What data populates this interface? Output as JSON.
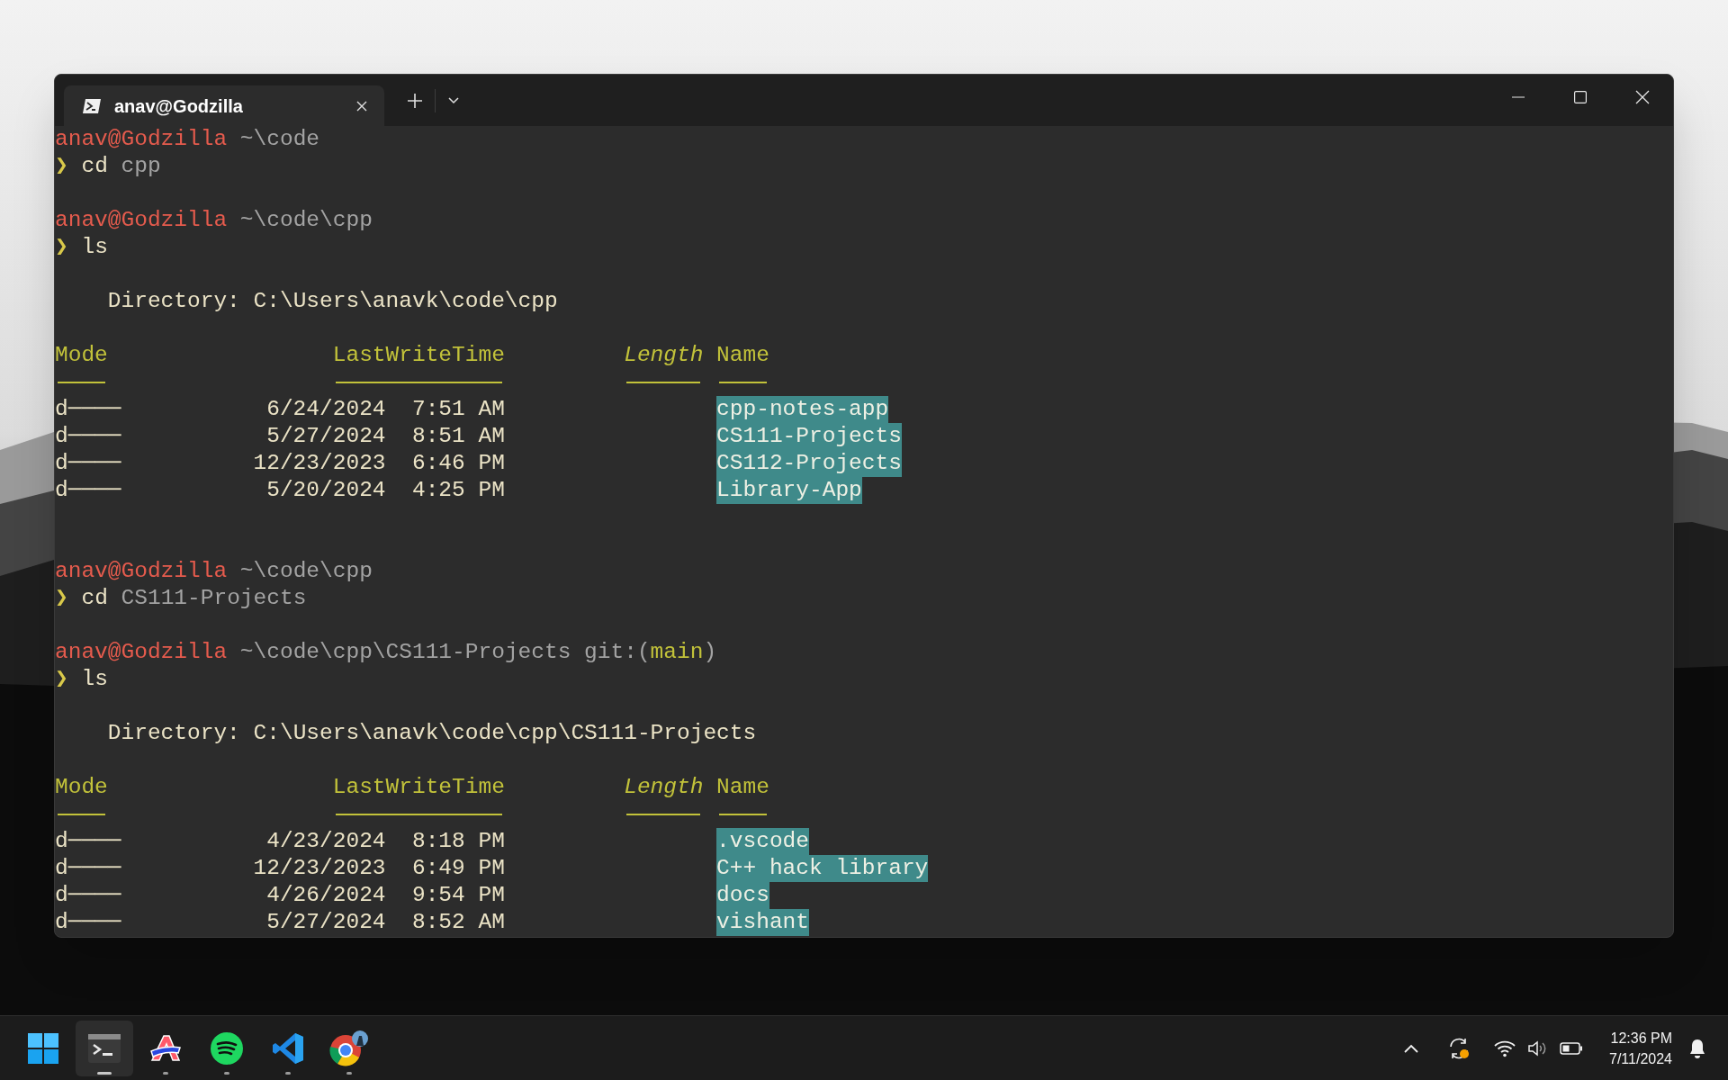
{
  "window": {
    "tabs": [
      {
        "title": "anav@Godzilla",
        "selected": true
      }
    ]
  },
  "terminal": {
    "lines": [
      {
        "kind": "text",
        "segments": [
          {
            "text": "anav@Godzilla",
            "kind": "user"
          },
          {
            "text": "~\\code",
            "kind": "path"
          }
        ]
      },
      {
        "kind": "text",
        "segments": [
          {
            "text": "❯",
            "kind": "prompt"
          },
          {
            "text": "cd",
            "kind": "command"
          },
          {
            "text": "cpp",
            "kind": "arg"
          }
        ]
      },
      {
        "kind": "blank"
      },
      {
        "kind": "text",
        "segments": [
          {
            "text": "anav@Godzilla",
            "kind": "user"
          },
          {
            "text": "~\\code\\cpp",
            "kind": "path"
          }
        ]
      },
      {
        "kind": "text",
        "segments": [
          {
            "text": "❯",
            "kind": "prompt"
          },
          {
            "text": "ls",
            "kind": "command"
          }
        ]
      },
      {
        "kind": "blank"
      },
      {
        "kind": "directory",
        "text": "Directory: C:\\Users\\anavk\\code\\cpp"
      },
      {
        "kind": "blank"
      },
      {
        "kind": "table_head",
        "mode": "Mode",
        "time": "LastWriteTime",
        "length": "Length",
        "name": "Name"
      },
      {
        "kind": "table_rule"
      },
      {
        "kind": "table_row",
        "mode": "d────",
        "date": "6/24/2024",
        "time": "7:51 AM",
        "name": "cpp-notes-app"
      },
      {
        "kind": "table_row",
        "mode": "d────",
        "date": "5/27/2024",
        "time": "8:51 AM",
        "name": "CS111-Projects"
      },
      {
        "kind": "table_row",
        "mode": "d────",
        "date": "12/23/2023",
        "time": "6:46 PM",
        "name": "CS112-Projects"
      },
      {
        "kind": "table_row",
        "mode": "d────",
        "date": "5/20/2024",
        "time": "4:25 PM",
        "name": "Library-App"
      },
      {
        "kind": "blank"
      },
      {
        "kind": "blank"
      },
      {
        "kind": "text",
        "segments": [
          {
            "text": "anav@Godzilla",
            "kind": "user"
          },
          {
            "text": "~\\code\\cpp",
            "kind": "path"
          }
        ]
      },
      {
        "kind": "text",
        "segments": [
          {
            "text": "❯",
            "kind": "prompt"
          },
          {
            "text": "cd",
            "kind": "command"
          },
          {
            "text": "CS111-Projects",
            "kind": "arg"
          }
        ]
      },
      {
        "kind": "blank"
      },
      {
        "kind": "text",
        "segments": [
          {
            "text": "anav@Godzilla",
            "kind": "user"
          },
          {
            "text": "~\\code\\cpp\\CS111-Projects",
            "kind": "path"
          },
          {
            "text": "git:(",
            "kind": "git"
          },
          {
            "text": "main",
            "kind": "branch"
          },
          {
            "text": ")",
            "kind": "git_end"
          }
        ]
      },
      {
        "kind": "text",
        "segments": [
          {
            "text": "❯",
            "kind": "prompt"
          },
          {
            "text": "ls",
            "kind": "command"
          }
        ]
      },
      {
        "kind": "blank"
      },
      {
        "kind": "directory",
        "text": "Directory: C:\\Users\\anavk\\code\\cpp\\CS111-Projects"
      },
      {
        "kind": "blank"
      },
      {
        "kind": "table_head",
        "mode": "Mode",
        "time": "LastWriteTime",
        "length": "Length",
        "name": "Name"
      },
      {
        "kind": "table_rule"
      },
      {
        "kind": "table_row",
        "mode": "d────",
        "date": "4/23/2024",
        "time": "8:18 PM",
        "name": ".vscode"
      },
      {
        "kind": "table_row",
        "mode": "d────",
        "date": "12/23/2023",
        "time": "6:49 PM",
        "name": "C++ hack library"
      },
      {
        "kind": "table_row",
        "mode": "d────",
        "date": "4/26/2024",
        "time": "9:54 PM",
        "name": "docs"
      },
      {
        "kind": "table_row",
        "mode": "d────",
        "date": "5/27/2024",
        "time": "8:52 AM",
        "name": "vishant"
      }
    ]
  },
  "taskbar": {
    "apps": [
      {
        "kind": "start",
        "selected": false,
        "running": false
      },
      {
        "kind": "terminal",
        "selected": true,
        "running": true
      },
      {
        "kind": "letter_a",
        "selected": false,
        "running": true
      },
      {
        "kind": "waves",
        "selected": false,
        "running": true
      },
      {
        "kind": "ribbon",
        "selected": false,
        "running": true
      },
      {
        "kind": "browser",
        "selected": false,
        "running": true
      }
    ],
    "clock": {
      "time": "12:36 PM",
      "date": "7/11/2024"
    }
  }
}
